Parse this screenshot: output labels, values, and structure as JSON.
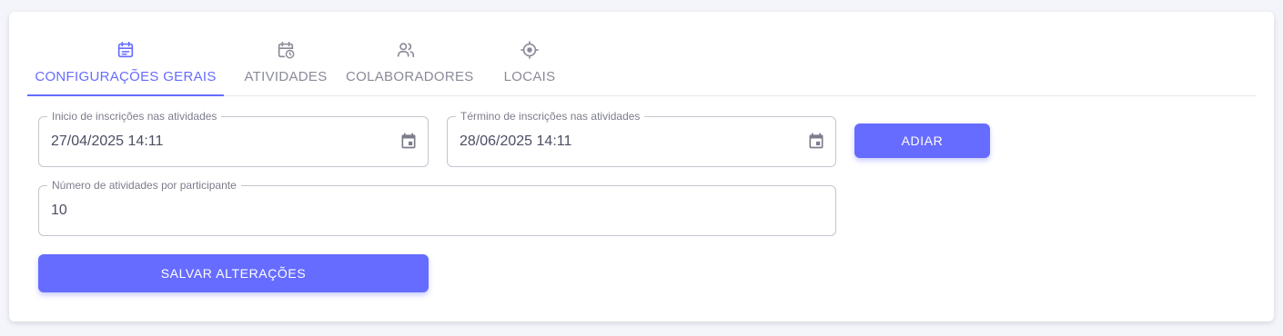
{
  "tabs": [
    {
      "label": "CONFIGURAÇÕES GERAIS",
      "icon": "calendar-icon",
      "active": true
    },
    {
      "label": "ATIVIDADES",
      "icon": "calendar-clock-icon",
      "active": false
    },
    {
      "label": "COLABORADORES",
      "icon": "people-icon",
      "active": false
    },
    {
      "label": "LOCAIS",
      "icon": "crosshair-icon",
      "active": false
    }
  ],
  "form": {
    "start": {
      "label": "Inicio de inscrições nas atividades",
      "value": "27/04/2025 14:11"
    },
    "end": {
      "label": "Término de inscrições nas atividades",
      "value": "28/06/2025 14:11"
    },
    "count": {
      "label": "Número de atividades por participante",
      "value": "10"
    }
  },
  "buttons": {
    "postpone": "ADIAR",
    "save": "SALVAR ALTERAÇÕES"
  },
  "colors": {
    "accent": "#666cff",
    "inactive_tab": "#8a8b99",
    "text": "#4c4e64"
  }
}
